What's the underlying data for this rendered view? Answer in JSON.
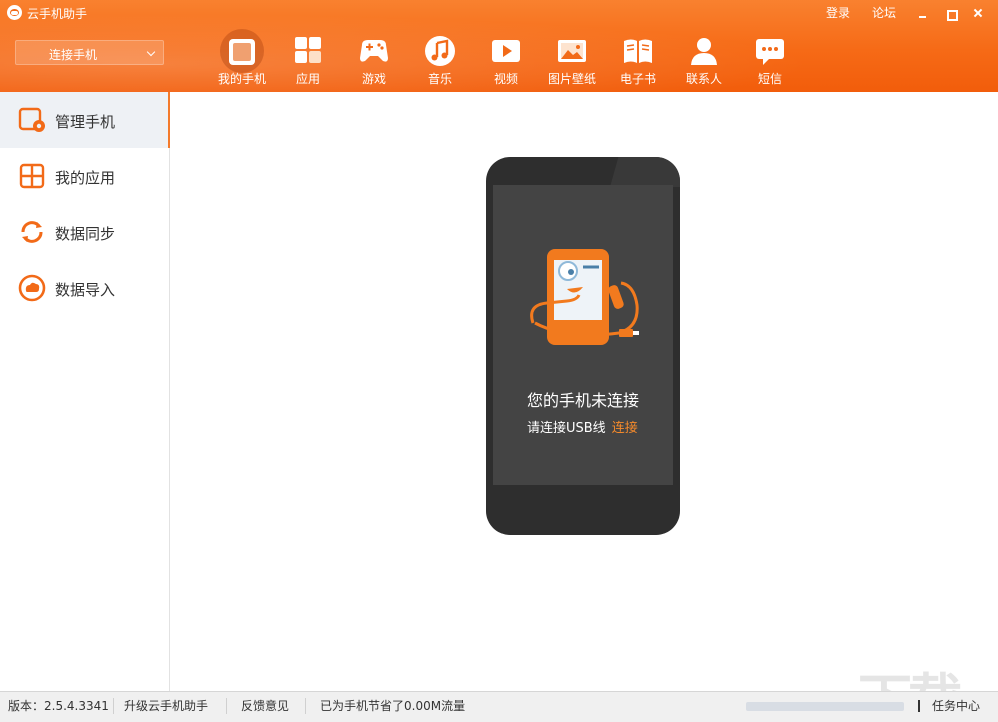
{
  "app": {
    "title": "云手机助手"
  },
  "header": {
    "links": {
      "login": "登录",
      "forum": "论坛"
    },
    "connect_select": "连接手机",
    "nav": [
      {
        "label": "我的手机",
        "icon": "phone-icon",
        "active": true
      },
      {
        "label": "应用",
        "icon": "apps-grid-icon"
      },
      {
        "label": "游戏",
        "icon": "gamepad-icon"
      },
      {
        "label": "音乐",
        "icon": "music-note-icon"
      },
      {
        "label": "视频",
        "icon": "video-play-icon"
      },
      {
        "label": "图片壁纸",
        "icon": "picture-icon"
      },
      {
        "label": "电子书",
        "icon": "book-icon"
      },
      {
        "label": "联系人",
        "icon": "contact-person-icon"
      },
      {
        "label": "短信",
        "icon": "message-icon"
      }
    ]
  },
  "sidebar": {
    "items": [
      {
        "label": "管理手机",
        "icon": "manage-phone-icon",
        "active": true
      },
      {
        "label": "我的应用",
        "icon": "my-apps-icon"
      },
      {
        "label": "数据同步",
        "icon": "sync-icon"
      },
      {
        "label": "数据导入",
        "icon": "cloud-import-icon"
      }
    ]
  },
  "main": {
    "status_title": "您的手机未连接",
    "status_hint": "请连接USB线",
    "connect_link": "连接"
  },
  "statusbar": {
    "version": "版本：2.5.4.3341",
    "upgrade": "升级云手机助手",
    "feedback": "反馈意见",
    "saved": "已为手机节省了0.00M流量",
    "task_center": "任务中心"
  },
  "watermark": "下载吧",
  "colors": {
    "accent": "#f26a18",
    "link": "#f58a2b"
  }
}
